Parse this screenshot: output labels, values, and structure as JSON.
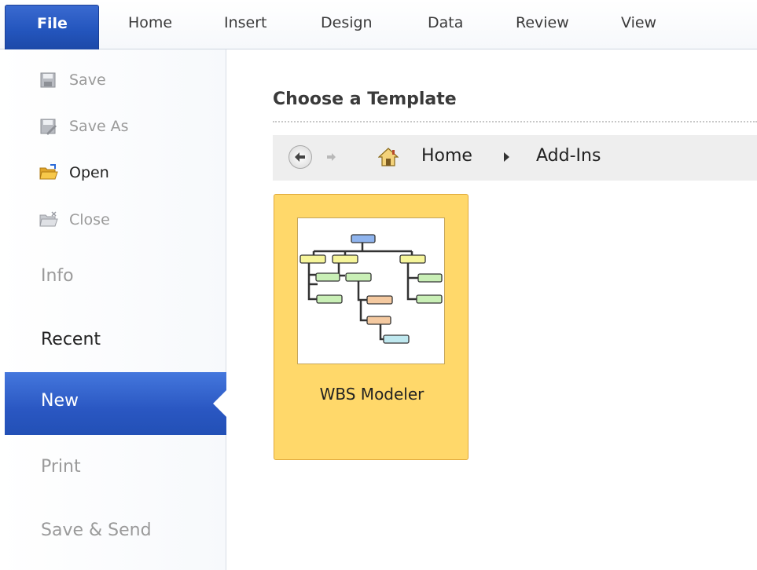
{
  "tabs": {
    "file": "File",
    "items": [
      "Home",
      "Insert",
      "Design",
      "Data",
      "Review",
      "View"
    ]
  },
  "backstage": {
    "commands": [
      {
        "label": "Save",
        "icon": "save-icon",
        "enabled": false
      },
      {
        "label": "Save As",
        "icon": "save-as-icon",
        "enabled": false
      },
      {
        "label": "Open",
        "icon": "open-folder-icon",
        "enabled": true
      },
      {
        "label": "Close",
        "icon": "close-folder-icon",
        "enabled": false
      }
    ],
    "sections": [
      {
        "label": "Info",
        "enabled": false
      },
      {
        "label": "Recent",
        "enabled": true
      },
      {
        "label": "New",
        "selected": true
      },
      {
        "label": "Print",
        "enabled": false
      },
      {
        "label": "Save & Send",
        "enabled": false
      }
    ]
  },
  "main": {
    "title": "Choose a Template",
    "breadcrumb": {
      "home_icon": "home-icon",
      "items": [
        "Home",
        "Add-Ins"
      ]
    },
    "templates": [
      {
        "label": "WBS Modeler",
        "selected": true
      }
    ]
  },
  "colors": {
    "accent": "#2a57c2",
    "tile_selected": "#ffd86a",
    "disabled_text": "#9a9a9a"
  }
}
